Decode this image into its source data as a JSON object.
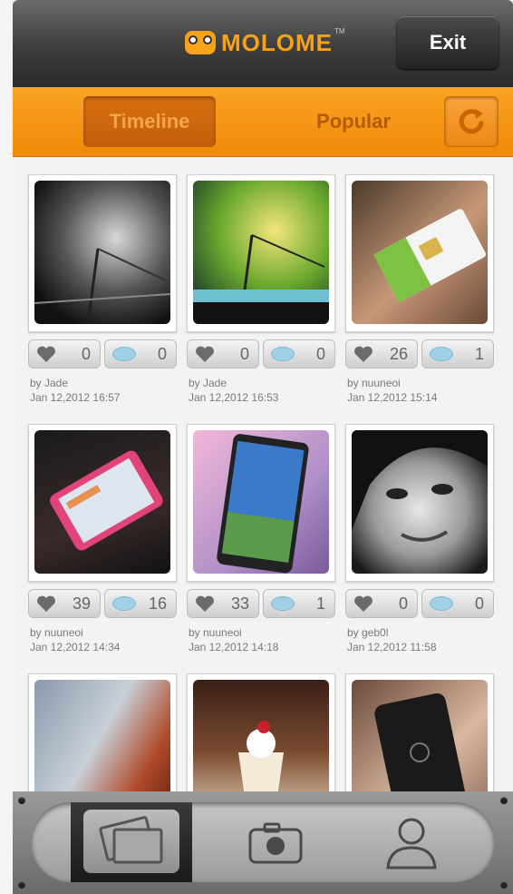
{
  "header": {
    "logo_text": "MOLOME",
    "logo_tm": "TM",
    "exit_label": "Exit"
  },
  "tabs": {
    "timeline_label": "Timeline",
    "popular_label": "Popular",
    "active": "Timeline"
  },
  "photos": [
    {
      "likes": "0",
      "comments": "0",
      "by": "by Jade",
      "date": "Jan 12,2012  16:57"
    },
    {
      "likes": "0",
      "comments": "0",
      "by": "by Jade",
      "date": "Jan 12,2012  16:53"
    },
    {
      "likes": "26",
      "comments": "1",
      "by": "by nuuneoi",
      "date": "Jan 12,2012  15:14"
    },
    {
      "likes": "39",
      "comments": "16",
      "by": "by nuuneoi",
      "date": "Jan 12,2012  14:34"
    },
    {
      "likes": "33",
      "comments": "1",
      "by": "by nuuneoi",
      "date": "Jan 12,2012  14:18"
    },
    {
      "likes": "0",
      "comments": "0",
      "by": "by geb0l",
      "date": "Jan 12,2012  11:58"
    }
  ],
  "bottom_nav": {
    "items": [
      "gallery-icon",
      "camera-icon",
      "profile-icon"
    ],
    "active": "gallery-icon"
  },
  "colors": {
    "accent": "#f6a21a",
    "tabbar": "#f5960f",
    "header": "#3d3d3d"
  }
}
